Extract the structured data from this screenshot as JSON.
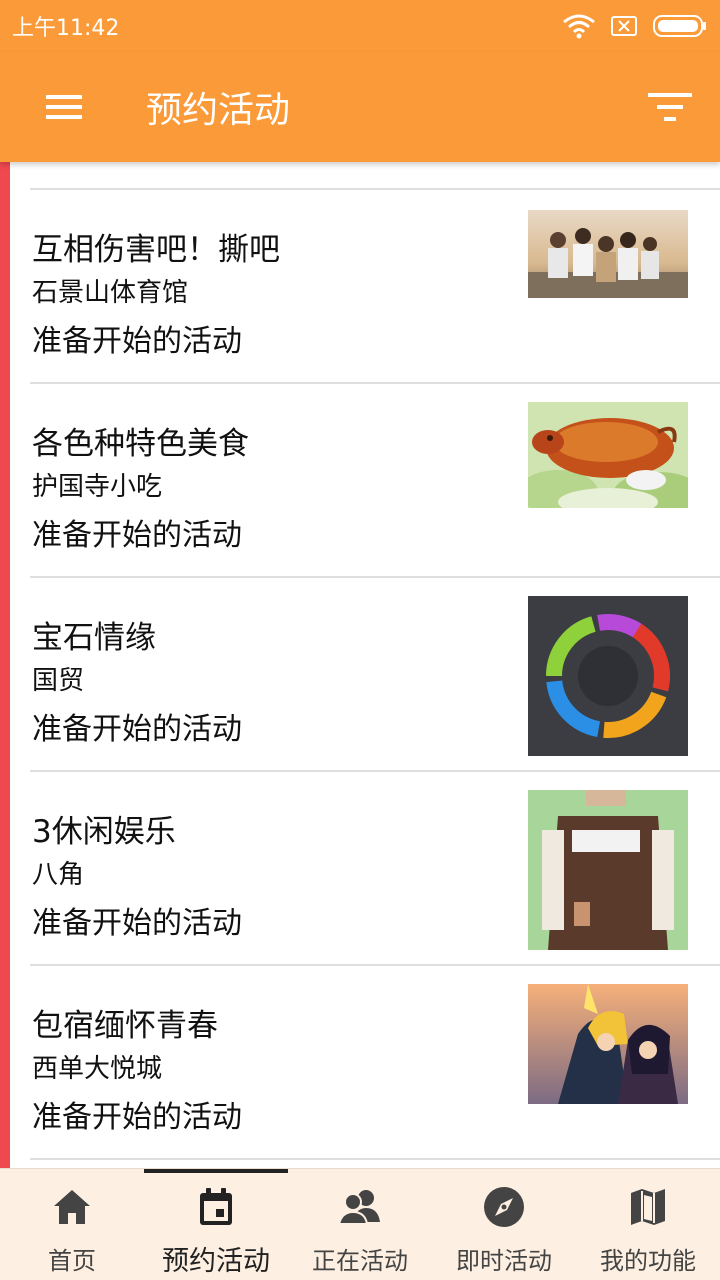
{
  "status": {
    "time": "上午11:42"
  },
  "appbar": {
    "title": "预约活动"
  },
  "colors": {
    "brand": "#fb9a38",
    "accent_edge": "#f0484f",
    "nav_bg": "#fdf0e2"
  },
  "items": [
    {
      "title": "互相伤害吧！撕吧",
      "location": "石景山体育馆",
      "status": "准备开始的活动",
      "image": "group-photo"
    },
    {
      "title": "各色种特色美食",
      "location": "护国寺小吃",
      "status": "准备开始的活动",
      "image": "roast-pig"
    },
    {
      "title": "宝石情缘",
      "location": "国贸",
      "status": "准备开始的活动",
      "image": "elemental-circle"
    },
    {
      "title": "3休闲娱乐",
      "location": "八角",
      "status": "准备开始的活动",
      "image": "shirt-back"
    },
    {
      "title": "包宿缅怀青春",
      "location": "西单大悦城",
      "status": "准备开始的活动",
      "image": "anime-art"
    }
  ],
  "nav": {
    "tabs": [
      {
        "label": "首页",
        "icon": "home-icon"
      },
      {
        "label": "预约活动",
        "icon": "calendar-icon",
        "active": true
      },
      {
        "label": "正在活动",
        "icon": "people-icon"
      },
      {
        "label": "即时活动",
        "icon": "compass-icon"
      },
      {
        "label": "我的功能",
        "icon": "map-icon"
      }
    ]
  }
}
